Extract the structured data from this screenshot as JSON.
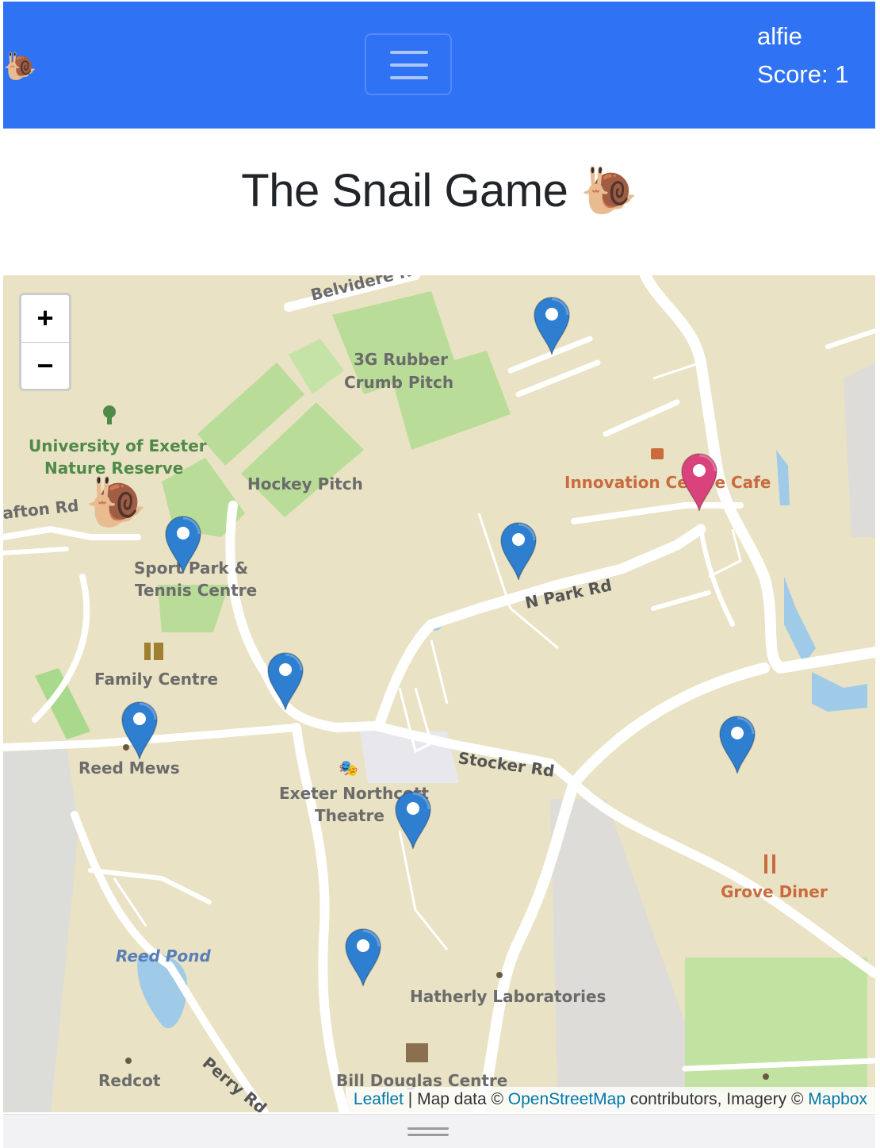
{
  "navbar": {
    "brand_icon": "🐌",
    "username": "alfie",
    "score_text": "Score: 1",
    "menu_icon": "hamburger-icon",
    "background": "#2f72f4"
  },
  "page": {
    "title": "The Snail Game 🐌"
  },
  "map": {
    "zoom_in_label": "+",
    "zoom_out_label": "−",
    "labels": {
      "belvidere": "Belvidere R",
      "pitch_3g_1": "3G Rubber",
      "pitch_3g_2": "Crumb Pitch",
      "reserve_1": "University of Exeter",
      "reserve_2": "Nature Reserve",
      "hockey": "Hockey Pitch",
      "innovation": "Innovation Centre Cafe",
      "afton": "afton Rd",
      "sport_1": "Sport Park &",
      "sport_2": "Tennis Centre",
      "npark": "N Park Rd",
      "family": "Family Centre",
      "reed_mews": "Reed Mews",
      "stocker": "Stocker Rd",
      "northcott_1": "Exeter Northcott",
      "northcott_2": "Theatre",
      "grove": "Grove Diner",
      "reed_pond": "Reed Pond",
      "hatherly": "Hatherly Laboratories",
      "redcot": "Redcot",
      "perry": "Perry Rd",
      "bill_douglas": "Bill Douglas Centre"
    },
    "marker_colors": {
      "default": "#2e7fd0",
      "selected": "#d9427a"
    },
    "snail_icon": "🐌",
    "attribution": {
      "leaflet": "Leaflet",
      "sep1": " | Map data © ",
      "osm": "OpenStreetMap",
      "sep2": " contributors, Imagery © ",
      "mapbox": "Mapbox"
    }
  }
}
